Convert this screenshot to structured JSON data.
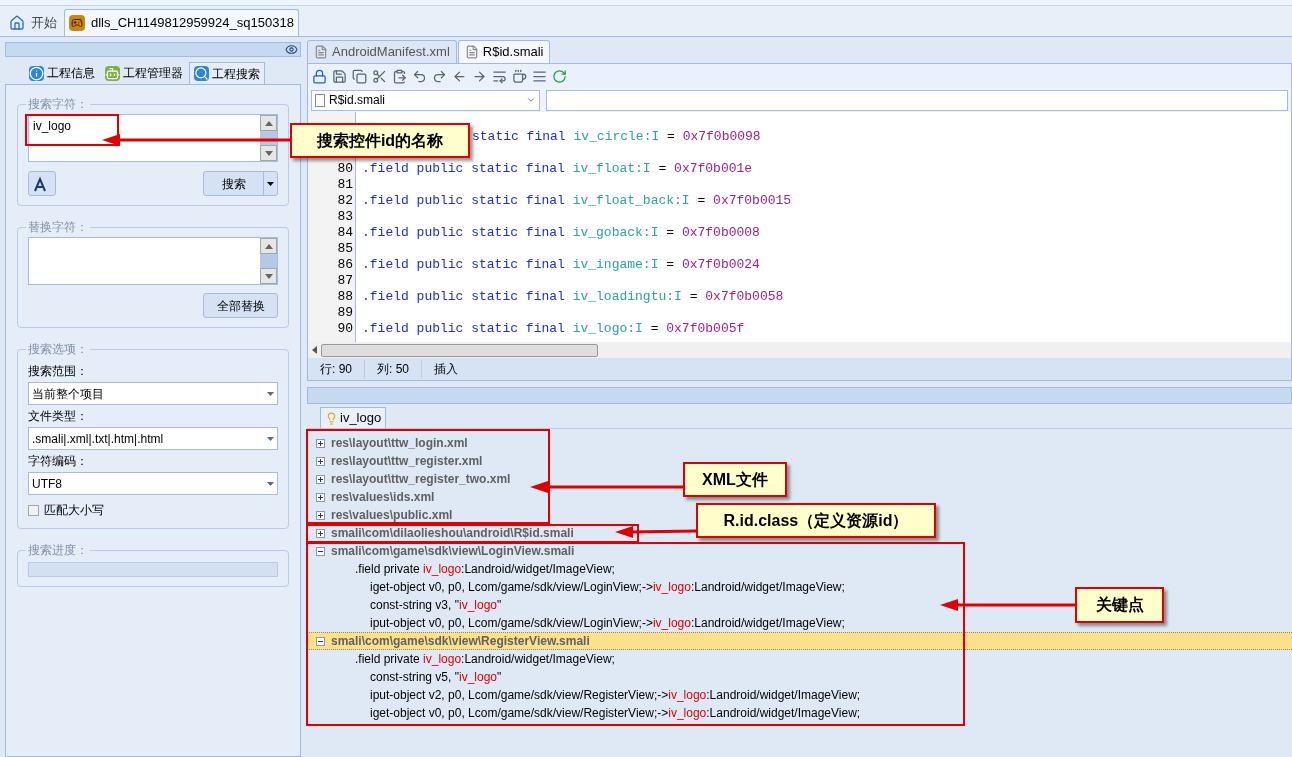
{
  "app_tabs": [
    {
      "label": "开始",
      "selected": false,
      "kind": "home"
    },
    {
      "label": "dlls_CH1149812959924_sq150318",
      "selected": true,
      "kind": "project"
    }
  ],
  "left_panel": {
    "tabs": [
      {
        "label": "工程信息",
        "selected": false,
        "kind": "info"
      },
      {
        "label": "工程管理器",
        "selected": false,
        "kind": "android"
      },
      {
        "label": "工程搜索",
        "selected": true,
        "kind": "search"
      }
    ],
    "search_group": {
      "title": "搜索字符：",
      "value": "iv_logo",
      "button": "搜索"
    },
    "replace_group": {
      "title": "替换字符：",
      "button": "全部替换"
    },
    "options_group": {
      "title": "搜索选项：",
      "fields": [
        {
          "label": "搜索范围：",
          "value": "当前整个项目"
        },
        {
          "label": "文件类型：",
          "value": ".smali|.xml|.txt|.htm|.html"
        },
        {
          "label": "字符编码：",
          "value": "UTF8"
        }
      ],
      "match_case": {
        "label": "匹配大小写",
        "checked": false
      }
    },
    "progress_group": {
      "title": "搜索进度：",
      "level": 0
    }
  },
  "editor": {
    "tabs": [
      {
        "label": "AndroidManifest.xml",
        "selected": false
      },
      {
        "label": "R$id.smali",
        "selected": true
      }
    ],
    "file_combo": "R$id.smali",
    "code_lines": [
      {
        "tokens": [
          {
            "kind": "keyword",
            "text": "static final"
          },
          {
            "kind": "name",
            "text": "iv_circle:I"
          },
          {
            "kind": "op",
            "text": "="
          },
          {
            "kind": "hex",
            "text": "0x7f0b0098"
          }
        ]
      },
      {
        "number": "80",
        "tokens": [
          {
            "kind": "keyword",
            "text": ".field public static final"
          },
          {
            "kind": "name",
            "text": "iv_float:I"
          },
          {
            "kind": "op",
            "text": "="
          },
          {
            "kind": "hex",
            "text": "0x7f0b001e"
          }
        ]
      },
      {
        "number": "81"
      },
      {
        "number": "82",
        "tokens": [
          {
            "kind": "keyword",
            "text": ".field public static final"
          },
          {
            "kind": "name",
            "text": "iv_float_back:I"
          },
          {
            "kind": "op",
            "text": "="
          },
          {
            "kind": "hex",
            "text": "0x7f0b0015"
          }
        ]
      },
      {
        "number": "83"
      },
      {
        "number": "84",
        "tokens": [
          {
            "kind": "keyword",
            "text": ".field public static final"
          },
          {
            "kind": "name",
            "text": "iv_goback:I"
          },
          {
            "kind": "op",
            "text": "="
          },
          {
            "kind": "hex",
            "text": "0x7f0b0008"
          }
        ]
      },
      {
        "number": "85"
      },
      {
        "number": "86",
        "tokens": [
          {
            "kind": "keyword",
            "text": ".field public static final"
          },
          {
            "kind": "name",
            "text": "iv_ingame:I"
          },
          {
            "kind": "op",
            "text": "="
          },
          {
            "kind": "hex",
            "text": "0x7f0b0024"
          }
        ]
      },
      {
        "number": "87"
      },
      {
        "number": "88",
        "tokens": [
          {
            "kind": "keyword",
            "text": ".field public static final"
          },
          {
            "kind": "name",
            "text": "iv_loadingtu:I"
          },
          {
            "kind": "op",
            "text": "="
          },
          {
            "kind": "hex",
            "text": "0x7f0b0058"
          }
        ]
      },
      {
        "number": "89"
      },
      {
        "number": "90",
        "tokens": [
          {
            "kind": "keyword",
            "text": ".field public static final"
          },
          {
            "kind": "name",
            "text": "iv_logo:I"
          },
          {
            "kind": "op",
            "text": "="
          },
          {
            "kind": "hex",
            "text": "0x7f0b005f"
          }
        ]
      }
    ],
    "status": [
      "行: 90",
      "列: 50",
      "插入"
    ]
  },
  "results": {
    "tab": "iv_logo",
    "tree": [
      {
        "label": "res\\layout\\ttw_login.xml",
        "expanded": false,
        "selected": false
      },
      {
        "label": "res\\layout\\ttw_register.xml",
        "expanded": false,
        "selected": false
      },
      {
        "label": "res\\layout\\ttw_register_two.xml",
        "expanded": false,
        "selected": false
      },
      {
        "label": "res\\values\\ids.xml",
        "expanded": false,
        "selected": false
      },
      {
        "label": "res\\values\\public.xml",
        "expanded": false,
        "selected": false
      },
      {
        "label": "smali\\com\\dilaolieshou\\android\\R$id.smali",
        "expanded": false,
        "selected": false
      },
      {
        "label": "smali\\com\\game\\sdk\\view\\LoginView.smali",
        "expanded": true,
        "selected": false,
        "children": [
          {
            "kind": "field",
            "parts": [
              {
                "text": ".field private "
              },
              {
                "text": "iv_logo",
                "match": true
              },
              {
                "text": ":Landroid/widget/ImageView;"
              }
            ]
          },
          {
            "kind": "instruction",
            "parts": [
              {
                "text": "iget-object v0, p0, Lcom/game/sdk/view/LoginView;->"
              },
              {
                "text": "iv_logo",
                "match": true
              },
              {
                "text": ":Landroid/widget/ImageView;"
              }
            ]
          },
          {
            "kind": "instruction",
            "parts": [
              {
                "text": "const-string v3, \""
              },
              {
                "text": "iv_logo",
                "match": true
              },
              {
                "text": "\""
              }
            ]
          },
          {
            "kind": "instruction",
            "parts": [
              {
                "text": "iput-object v0, p0, Lcom/game/sdk/view/LoginView;->"
              },
              {
                "text": "iv_logo",
                "match": true
              },
              {
                "text": ":Landroid/widget/ImageView;"
              }
            ]
          }
        ]
      },
      {
        "label": "smali\\com\\game\\sdk\\view\\RegisterView.smali",
        "expanded": true,
        "selected": true,
        "children": [
          {
            "kind": "field",
            "parts": [
              {
                "text": ".field private "
              },
              {
                "text": "iv_logo",
                "match": true
              },
              {
                "text": ":Landroid/widget/ImageView;"
              }
            ]
          },
          {
            "kind": "instruction",
            "parts": [
              {
                "text": "const-string v5, \""
              },
              {
                "text": "iv_logo",
                "match": true
              },
              {
                "text": "\""
              }
            ]
          },
          {
            "kind": "instruction",
            "parts": [
              {
                "text": "iput-object v2, p0, Lcom/game/sdk/view/RegisterView;->"
              },
              {
                "text": "iv_logo",
                "match": true
              },
              {
                "text": ":Landroid/widget/ImageView;"
              }
            ]
          },
          {
            "kind": "instruction",
            "parts": [
              {
                "text": "iget-object v0, p0, Lcom/game/sdk/view/RegisterView;->"
              },
              {
                "text": "iv_logo",
                "match": true
              },
              {
                "text": ":Landroid/widget/ImageView;"
              }
            ]
          }
        ]
      }
    ]
  },
  "annotations": [
    {
      "text": "搜索控件id的名称"
    },
    {
      "text": "XML文件"
    },
    {
      "text": "R.id.class（定义资源id）"
    },
    {
      "text": "关键点"
    }
  ]
}
